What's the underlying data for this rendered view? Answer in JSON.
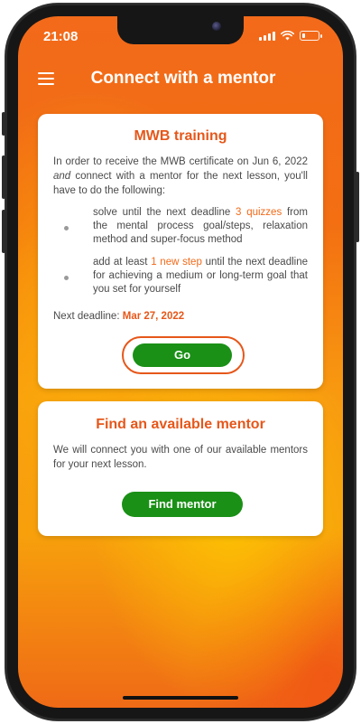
{
  "status_bar": {
    "time": "21:08",
    "icons": [
      "cellular-signal-icon",
      "wifi-icon",
      "battery-icon"
    ],
    "battery_level": 0.2
  },
  "header": {
    "menu_icon": "hamburger-menu-icon",
    "title": "Connect with a mentor"
  },
  "training_card": {
    "title": "MWB training",
    "intro_pre": "In order to receive the MWB certificate on Jun 6, 2022 ",
    "intro_em": "and",
    "intro_post": " connect with a mentor for the next lesson, you'll have to do the following:",
    "items": [
      {
        "pre": "solve until the next deadline ",
        "highlight": "3 quizzes",
        "post": " from the mental process goal/steps, relaxation method and super-focus method"
      },
      {
        "pre": "add at least ",
        "highlight": "1 new step",
        "post": " until the next deadline for achieving a medium or long-term goal that you set for yourself"
      }
    ],
    "deadline_label": "Next deadline:",
    "deadline_value": "Mar 27, 2022",
    "go_button": "Go"
  },
  "mentor_card": {
    "title": "Find an available mentor",
    "description": "We will connect you with one of our available mentors for your next lesson.",
    "button": "Find mentor"
  },
  "colors": {
    "accent": "#e6571a",
    "highlight": "#f26a1a",
    "button_green": "#1a9016",
    "background_orange": "#f36f12",
    "background_yellow": "#f8a50c"
  }
}
